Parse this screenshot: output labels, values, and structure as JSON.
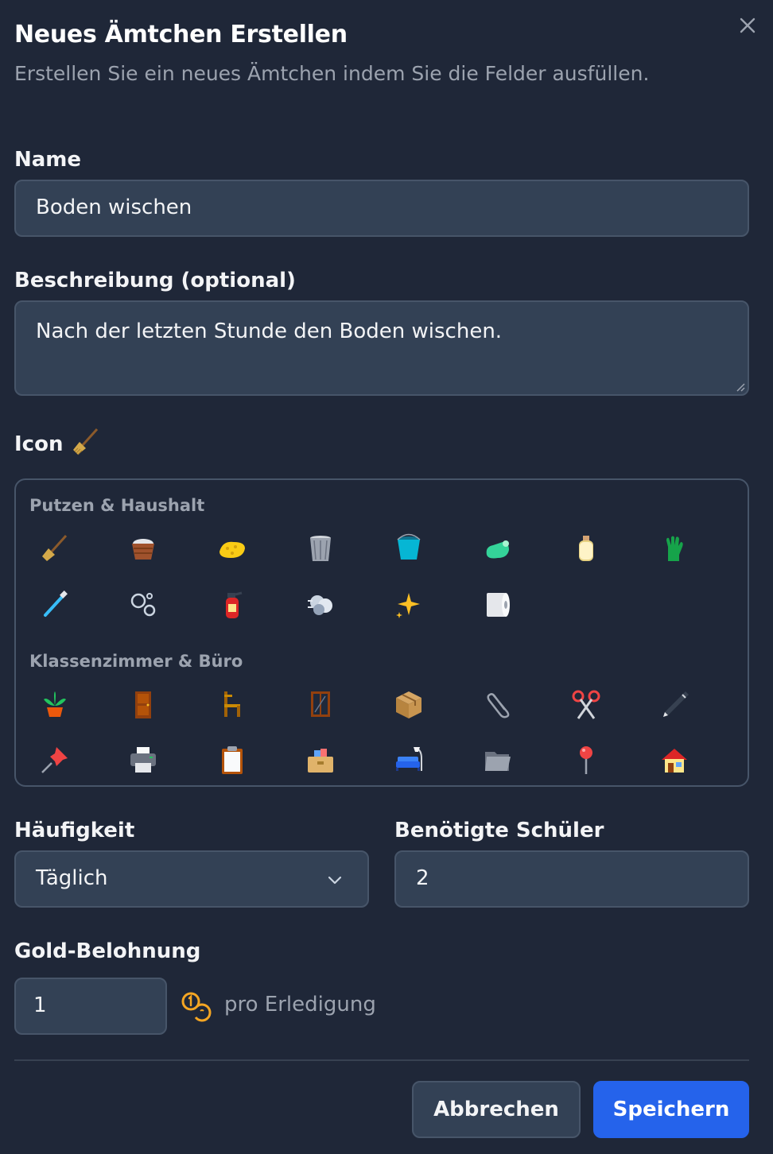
{
  "dialog": {
    "title": "Neues Ämtchen Erstellen",
    "subtitle": "Erstellen Sie ein neues Ämtchen indem Sie die Felder ausfüllen."
  },
  "name_field": {
    "label": "Name",
    "value": "Boden wischen"
  },
  "description_field": {
    "label": "Beschreibung (optional)",
    "value": "Nach der letzten Stunde den Boden wischen."
  },
  "icon_field": {
    "label": "Icon",
    "selected_icon": "broom-icon",
    "categories": [
      {
        "title": "Putzen & Haushalt",
        "icons": [
          "broom-icon",
          "laundry-basket-icon",
          "sponge-icon",
          "wastebasket-icon",
          "bucket-icon",
          "spray-bottle-icon",
          "lotion-bottle-icon",
          "glove-icon",
          "toothbrush-icon",
          "bubbles-icon",
          "fire-extinguisher-icon",
          "dust-cloud-icon",
          "sparkles-icon",
          "paper-roll-icon"
        ]
      },
      {
        "title": "Klassenzimmer & Büro",
        "icons": [
          "potted-plant-icon",
          "door-icon",
          "chair-icon",
          "window-icon",
          "package-icon",
          "paperclip-icon",
          "scissors-icon",
          "pen-icon",
          "pushpin-icon",
          "printer-icon",
          "clipboard-icon",
          "card-file-box-icon",
          "couch-icon",
          "file-folder-icon",
          "round-pushpin-icon",
          "house-icon"
        ]
      }
    ]
  },
  "frequency_field": {
    "label": "Häufigkeit",
    "value": "Täglich"
  },
  "students_field": {
    "label": "Benötigte Schüler",
    "value": "2"
  },
  "gold_field": {
    "label": "Gold-Belohnung",
    "value": "1",
    "suffix": "pro Erledigung",
    "coin_icon": "coins-icon"
  },
  "actions": {
    "cancel_label": "Abbrechen",
    "save_label": "Speichern"
  },
  "colors": {
    "background": "#1f2738",
    "field_bg": "#334155",
    "primary": "#2563eb",
    "muted_text": "#9ca3af",
    "coin": "#f5a623"
  }
}
